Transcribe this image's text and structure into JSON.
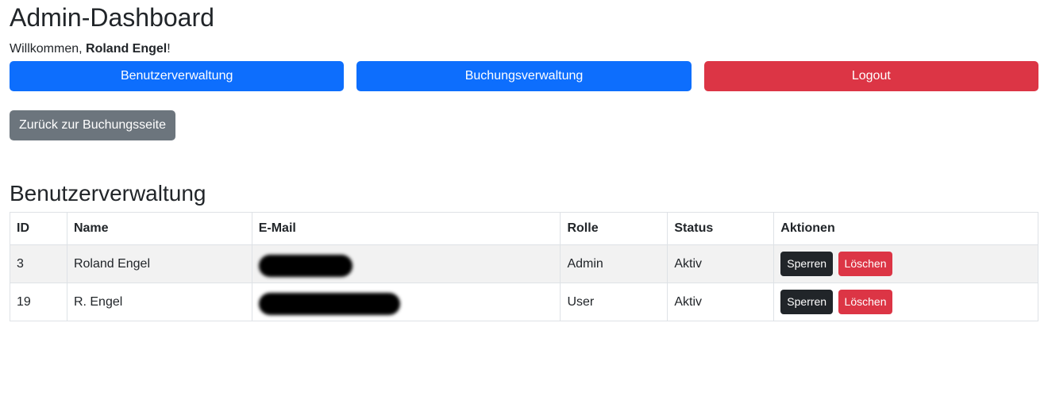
{
  "header": {
    "title": "Admin-Dashboard",
    "welcome_prefix": "Willkommen, ",
    "user_name": "Roland Engel",
    "welcome_suffix": "!"
  },
  "nav": {
    "user_management": "Benutzerverwaltung",
    "booking_management": "Buchungsverwaltung",
    "logout": "Logout"
  },
  "back_button": "Zurück zur Buchungsseite",
  "section": {
    "title": "Benutzerverwaltung"
  },
  "table": {
    "columns": [
      "ID",
      "Name",
      "E-Mail",
      "Rolle",
      "Status",
      "Aktionen"
    ],
    "rows": [
      {
        "id": "3",
        "name": "Roland Engel",
        "role": "Admin",
        "status": "Aktiv",
        "lock_label": "Sperren",
        "delete_label": "Löschen"
      },
      {
        "id": "19",
        "name": "R. Engel",
        "role": "User",
        "status": "Aktiv",
        "lock_label": "Sperren",
        "delete_label": "Löschen"
      }
    ]
  },
  "colors": {
    "primary": "#0d6efd",
    "danger": "#dc3545",
    "secondary": "#6c757d",
    "dark": "#212529"
  }
}
